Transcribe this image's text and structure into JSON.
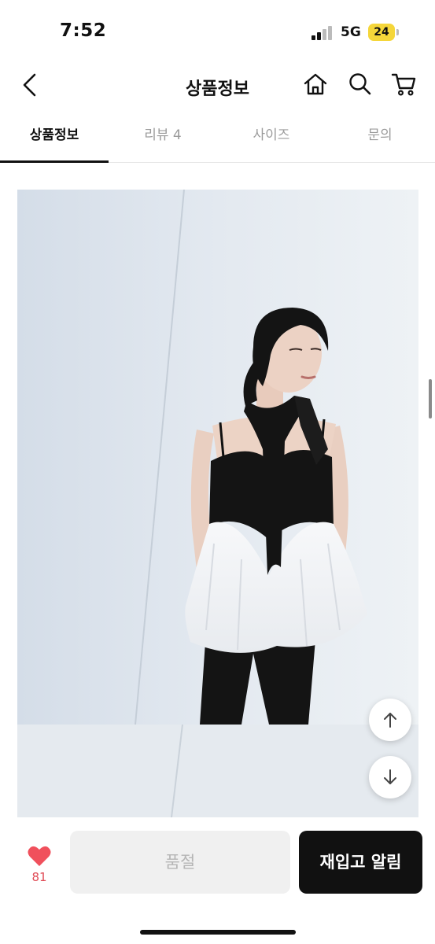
{
  "status_bar": {
    "time": "7:52",
    "network": "5G",
    "battery": "24"
  },
  "header": {
    "title": "상품정보",
    "icons": [
      "back-icon",
      "home-icon",
      "search-icon",
      "cart-icon"
    ]
  },
  "tabs": [
    {
      "label": "상품정보",
      "active": true
    },
    {
      "label": "리뷰 4",
      "active": false
    },
    {
      "label": "사이즈",
      "active": false
    },
    {
      "label": "문의",
      "active": false
    }
  ],
  "product_image": {
    "description_icon": "product-photo"
  },
  "floating": {
    "up_icon": "arrow-up-icon",
    "down_icon": "arrow-down-icon"
  },
  "bottom_bar": {
    "like_count": "81",
    "soldout_label": "품절",
    "restock_label": "재입고 알림"
  },
  "colors": {
    "accent": "#111111",
    "like": "#f0505c",
    "disabled_bg": "#f0f0f0"
  }
}
